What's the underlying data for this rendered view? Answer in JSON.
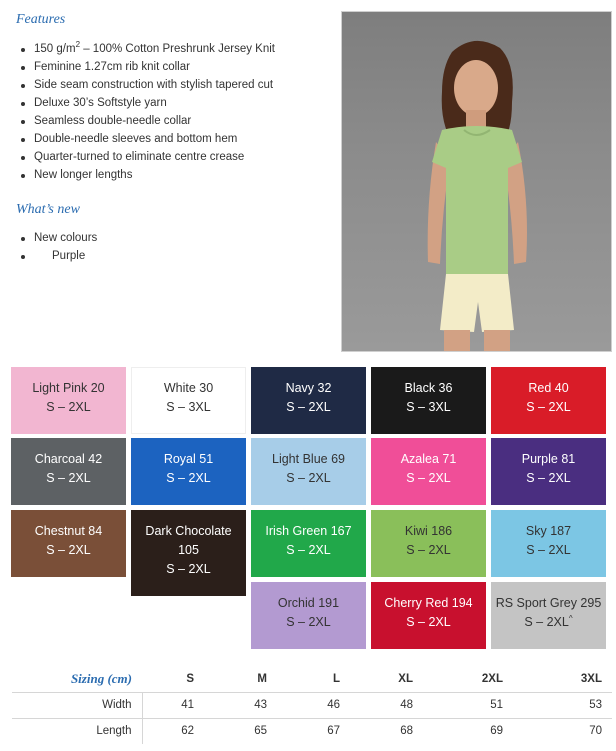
{
  "features": {
    "title": "Features",
    "items": [
      {
        "pre": "150 g/m",
        "sup": "2",
        "post": " – 100% Cotton Preshrunk Jersey Knit"
      },
      {
        "pre": "Feminine 1.27cm rib knit collar",
        "sup": "",
        "post": ""
      },
      {
        "pre": "Side seam construction with stylish tapered cut",
        "sup": "",
        "post": ""
      },
      {
        "pre": "Deluxe 30’s Softstyle yarn",
        "sup": "",
        "post": ""
      },
      {
        "pre": "Seamless double-needle collar",
        "sup": "",
        "post": ""
      },
      {
        "pre": "Double-needle sleeves and bottom hem",
        "sup": "",
        "post": ""
      },
      {
        "pre": "Quarter-turned to eliminate centre crease",
        "sup": "",
        "post": ""
      },
      {
        "pre": "New longer lengths",
        "sup": "",
        "post": ""
      }
    ]
  },
  "whats_new": {
    "title": "What’s new",
    "items": [
      "New colours"
    ],
    "sub_items": [
      "Purple"
    ]
  },
  "photo": {
    "shirt_color": "#a9cc86",
    "shorts_color": "#f3ecc8",
    "icon": "model-photo"
  },
  "swatches": [
    {
      "name": "Light Pink 20",
      "sizes": "S – 2XL",
      "color": "#f2b6d1",
      "text_color": "#333333"
    },
    {
      "name": "White 30",
      "sizes": "S – 3XL",
      "color": "#ffffff",
      "text_color": "#333333"
    },
    {
      "name": "Navy 32",
      "sizes": "S – 2XL",
      "color": "#1f2a45",
      "text_color": "#ffffff"
    },
    {
      "name": "Black 36",
      "sizes": "S – 3XL",
      "color": "#1a1a1a",
      "text_color": "#ffffff"
    },
    {
      "name": "Red 40",
      "sizes": "S – 2XL",
      "color": "#d91c28",
      "text_color": "#ffffff"
    },
    {
      "name": "Charcoal 42",
      "sizes": "S – 2XL",
      "color": "#5d6164",
      "text_color": "#ffffff"
    },
    {
      "name": "Royal 51",
      "sizes": "S – 2XL",
      "color": "#1c63c0",
      "text_color": "#ffffff"
    },
    {
      "name": "Light Blue 69",
      "sizes": "S – 2XL",
      "color": "#a7cde8",
      "text_color": "#333333"
    },
    {
      "name": "Azalea 71",
      "sizes": "S – 2XL",
      "color": "#f04e98",
      "text_color": "#ffffff"
    },
    {
      "name": "Purple 81",
      "sizes": "S – 2XL",
      "color": "#4a2e80",
      "text_color": "#ffffff"
    },
    {
      "name": "Chestnut 84",
      "sizes": "S – 2XL",
      "color": "#7a4f38",
      "text_color": "#ffffff"
    },
    {
      "name": "Dark Chocolate 105",
      "sizes": "S – 2XL",
      "color": "#2b1f1a",
      "text_color": "#ffffff"
    },
    {
      "name": "Irish Green 167",
      "sizes": "S – 2XL",
      "color": "#21a84a",
      "text_color": "#ffffff"
    },
    {
      "name": "Kiwi 186",
      "sizes": "S – 2XL",
      "color": "#8abf5a",
      "text_color": "#333333"
    },
    {
      "name": "Sky 187",
      "sizes": "S – 2XL",
      "color": "#7cc6e4",
      "text_color": "#333333"
    },
    {
      "name": "Orchid 191",
      "sizes": "S – 2XL",
      "color": "#b39ad1",
      "text_color": "#333333"
    },
    {
      "name": "Cherry Red 194",
      "sizes": "S – 2XL",
      "color": "#c8102e",
      "text_color": "#ffffff"
    },
    {
      "name": "RS Sport Grey 295",
      "sizes": "S – 2XL",
      "sup": "^",
      "color": "#c4c4c4",
      "text_color": "#333333"
    }
  ],
  "sizing": {
    "title": "Sizing (cm)",
    "columns": [
      "S",
      "M",
      "L",
      "XL",
      "2XL",
      "3XL"
    ],
    "rows": [
      {
        "label": "Width",
        "values": [
          "41",
          "43",
          "46",
          "48",
          "51",
          "53"
        ]
      },
      {
        "label": "Length",
        "values": [
          "62",
          "65",
          "67",
          "68",
          "69",
          "70"
        ]
      }
    ]
  }
}
